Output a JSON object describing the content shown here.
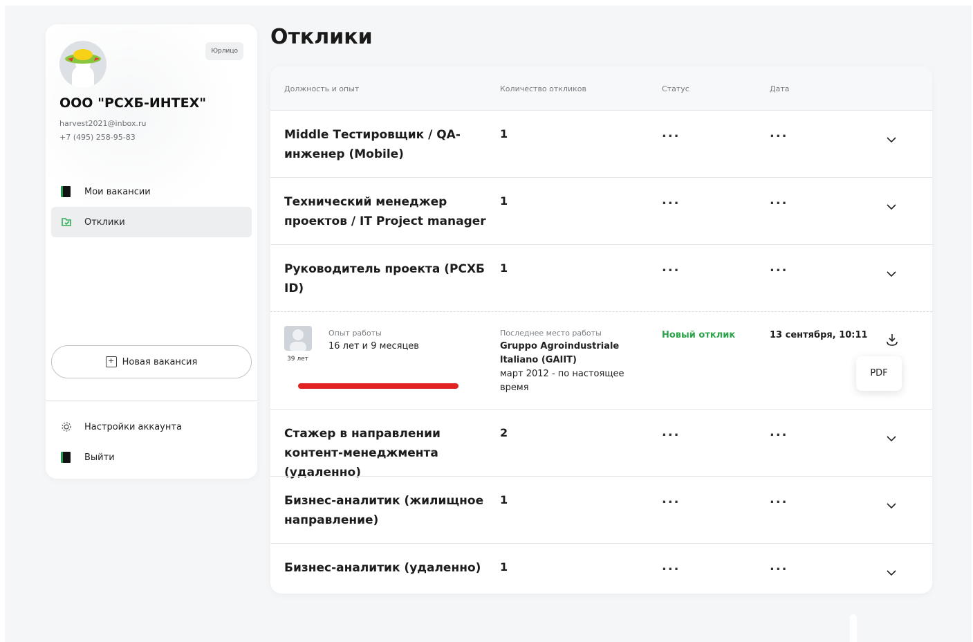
{
  "sidebar": {
    "badge": "Юрлицо",
    "company_name": "ООО \"РСХБ-ИНТЕХ\"",
    "email": "harvest2021@inbox.ru",
    "phone": "+7 (495) 258-95-83",
    "nav": [
      {
        "label": "Мои вакансии",
        "icon": "book-icon",
        "active": false
      },
      {
        "label": "Отклики",
        "icon": "folder-icon",
        "active": true
      }
    ],
    "new_vacancy_label": "Новая вакансия",
    "bottom_nav": [
      {
        "label": "Настройки аккаунта",
        "icon": "gear-icon"
      },
      {
        "label": "Выйти",
        "icon": "logout-icon"
      }
    ]
  },
  "page_title": "Отклики",
  "table": {
    "headers": [
      "Должность и опыт",
      "Количество откликов",
      "Статус",
      "Дата"
    ],
    "rows": [
      {
        "title": "Middle Тестировщик / QA-инженер (Mobile)",
        "count": "1",
        "status": "...",
        "date": "..."
      },
      {
        "title": "Технический менеджер проектов / IT Project manager",
        "count": "1",
        "status": "...",
        "date": "..."
      },
      {
        "title": "Руководитель проекта (РСХБ ID)",
        "count": "1",
        "status": "...",
        "date": "..."
      },
      {
        "title": "Стажер в направлении контент-менеджмента (удаленно)",
        "count": "2",
        "status": "...",
        "date": "..."
      },
      {
        "title": "Бизнес-аналитик (жилищное направление)",
        "count": "1",
        "status": "...",
        "date": "..."
      },
      {
        "title": "Бизнес-аналитик (удаленно)",
        "count": "1",
        "status": "...",
        "date": "..."
      }
    ],
    "expanded": {
      "age": "39 лет",
      "experience_label": "Опыт работы",
      "experience_value": "16 лет и 9 месяцев",
      "last_job_label": "Последнее место работы",
      "last_job_company": "Gruppo Agroindustriale ltaliano (GAIIT)",
      "last_job_period": "март 2012 - по настоящее время",
      "status": "Новый отклик",
      "date": "13 сентября, 10:11",
      "pdf_label": "PDF"
    }
  },
  "colors": {
    "accent_green": "#2ca24a",
    "highlight_red": "#e32222",
    "background": "#f5f6f7"
  }
}
